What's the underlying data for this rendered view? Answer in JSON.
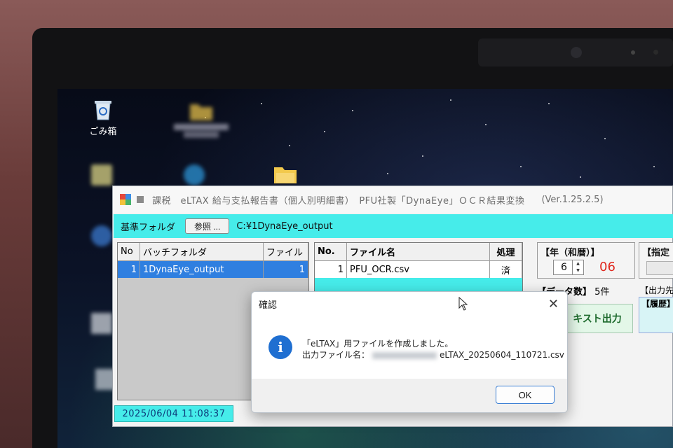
{
  "desktop": {
    "recycle_bin_label": "ごみ箱"
  },
  "window": {
    "title": "課税　eLTAX 給与支払報告書（個人別明細書）　PFU社製「DynaEye」ＯＣＲ結果変換",
    "version": "(Ver.1.25.2.5)",
    "folder_label": "基準フォルダ",
    "browse_button": "参照 ...",
    "folder_path": "C:¥1DynaEye_output",
    "batch_table": {
      "headers": [
        "No",
        "バッチフォルダ",
        "ファイル"
      ],
      "rows": [
        {
          "no": "1",
          "folder": "1DynaEye_output",
          "files": "1"
        }
      ]
    },
    "file_table": {
      "headers": [
        "No.",
        "ファイル名",
        "処理"
      ],
      "rows": [
        {
          "no": "1",
          "file": "PFU_OCR.csv",
          "status": "済"
        }
      ]
    },
    "year_label": "【年（和暦）】",
    "year_value": "6",
    "year_display": "06",
    "designation_label": "【指定",
    "data_count_label": "【データ数】",
    "data_count_value": "5件",
    "output_dest_label": "【出力先",
    "history_label": "【履歴】",
    "text_output_button": "キスト出力",
    "status_time": "2025/06/04 11:08:37"
  },
  "dialog": {
    "title": "確認",
    "message_line1": "「eLTAX」用ファイルを作成しました。",
    "message_line2_label": "出力ファイル名：",
    "message_file": "eLTAX_20250604_110721.csv",
    "ok_button": "OK"
  },
  "colors": {
    "cyan_bar": "#46ecea",
    "selection": "#2f7fe0",
    "year_red": "#e0281e",
    "info_blue": "#1f6fd1"
  }
}
